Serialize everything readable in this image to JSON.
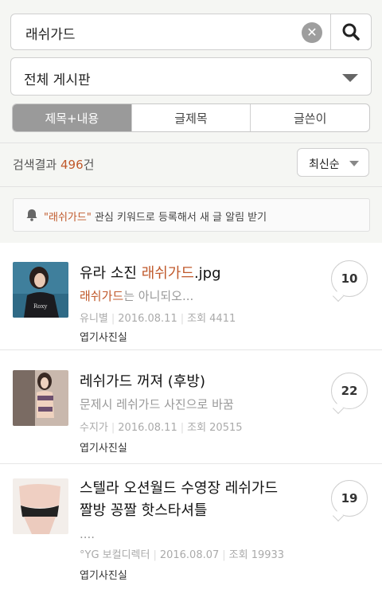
{
  "search": {
    "value": "래쉬가드",
    "placeholder": ""
  },
  "board_filter": {
    "selected": "전체 게시판"
  },
  "segments": [
    {
      "label": "제목+내용",
      "active": true
    },
    {
      "label": "글제목",
      "active": false
    },
    {
      "label": "글쓴이",
      "active": false
    }
  ],
  "results": {
    "prefix": "검색결과",
    "count": "496",
    "suffix": "건"
  },
  "sort": {
    "selected": "최신순"
  },
  "alert": {
    "keyword": "\"래쉬가드\"",
    "text": " 관심 키워드로 등록해서 새 글 알림 받기"
  },
  "posts": [
    {
      "title_pre": "유라 소진 ",
      "title_hl": "래쉬가드",
      "title_post": ".jpg",
      "title_line2": "",
      "snippet_hl": "래쉬가드",
      "snippet_rest": "는 아니되오...",
      "author": "유니별",
      "date": "2016.08.11",
      "views": "조회 4411",
      "category": "엽기사진실",
      "comments": "10"
    },
    {
      "title_pre": "레쉬가드 꺼져 (후방)",
      "title_hl": "",
      "title_post": "",
      "title_line2": "",
      "snippet_hl": "",
      "snippet_rest": "문제시 레쉬가드 사진으로 바꿈",
      "author": "수지가",
      "date": "2016.08.11",
      "views": "조회 20515",
      "category": "엽기사진실",
      "comments": "22"
    },
    {
      "title_pre": "스텔라 오션월드 수영장 레쉬가드",
      "title_hl": "",
      "title_post": "",
      "title_line2": "짤방 꽁짤 핫스타셔틀",
      "snippet_hl": "",
      "snippet_rest": "....",
      "author": "°YG 보컬디렉터",
      "date": "2016.08.07",
      "views": "조회 19933",
      "category": "엽기사진실",
      "comments": "19"
    }
  ],
  "colors": {
    "accent": "#c0592b",
    "segment_active": "#9a9a9a",
    "background": "#f5f6f3"
  },
  "icons": {
    "clear": "clear-icon",
    "search": "search-icon",
    "dropdown": "chevron-down-icon",
    "bell": "bell-icon"
  }
}
